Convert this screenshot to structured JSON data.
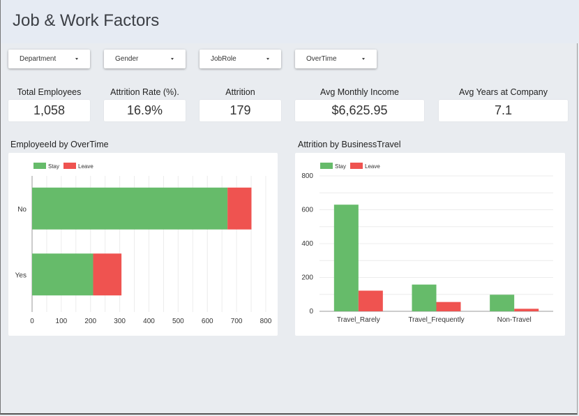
{
  "page": {
    "title": "Job & Work Factors"
  },
  "filters": [
    {
      "label": "Department"
    },
    {
      "label": "Gender"
    },
    {
      "label": "JobRole"
    },
    {
      "label": "OverTime"
    }
  ],
  "kpis": [
    {
      "label": "Total Employees",
      "value": "1,058"
    },
    {
      "label": "Attrition Rate (%).",
      "value": "16.9%"
    },
    {
      "label": "Attrition",
      "value": "179"
    },
    {
      "label": "Avg Monthly Income",
      "value": "$6,625.95"
    },
    {
      "label": "Avg Years at Company",
      "value": "7.1"
    }
  ],
  "colors": {
    "stay": "#66bb6a",
    "leave": "#ef5350"
  },
  "chart_data": [
    {
      "type": "bar",
      "orientation": "horizontal",
      "stacked": true,
      "title": "EmployeeId by OverTime",
      "categories": [
        "No",
        "Yes"
      ],
      "series": [
        {
          "name": "Stay",
          "values": [
            669,
            209
          ]
        },
        {
          "name": "Leave",
          "values": [
            82,
            97
          ]
        }
      ],
      "xlim": [
        0,
        800
      ],
      "xticks": [
        0,
        100,
        200,
        300,
        400,
        500,
        600,
        700,
        800
      ],
      "legend": "top-left",
      "grid": true
    },
    {
      "type": "bar",
      "orientation": "vertical",
      "stacked": false,
      "title": "Attrition by BusinessTravel",
      "categories": [
        "Travel_Rarely",
        "Travel_Frequently",
        "Non-Travel"
      ],
      "series": [
        {
          "name": "Stay",
          "values": [
            630,
            158,
            98
          ]
        },
        {
          "name": "Leave",
          "values": [
            122,
            55,
            15
          ]
        }
      ],
      "ylim": [
        0,
        800
      ],
      "yticks": [
        0,
        200,
        400,
        600,
        800
      ],
      "legend": "top-left",
      "grid": true
    }
  ]
}
